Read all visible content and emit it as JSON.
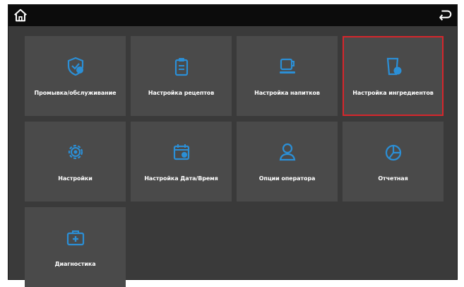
{
  "colors": {
    "screen_bg": "#3a3a3a",
    "tile_bg": "#4a4a4a",
    "icon_accent": "#2b8fd6",
    "selection": "#d6262c",
    "topbar_bg": "#0c0c0c"
  },
  "topbar": {
    "home_icon": "home-icon",
    "back_icon": "back-arrow-icon"
  },
  "tiles": [
    {
      "label": "Промывка/обслуживание",
      "icon": "shield-icon"
    },
    {
      "label": "Настройка рецептов",
      "icon": "clipboard-icon"
    },
    {
      "label": "Настройка напитков",
      "icon": "cup-icon"
    },
    {
      "label": "Настройка ингредиентов",
      "icon": "canister-icon"
    },
    {
      "label": "Настройки",
      "icon": "gear-icon"
    },
    {
      "label": "Настройка Дата/Время",
      "icon": "calendar-icon"
    },
    {
      "label": "Опции оператора",
      "icon": "user-icon"
    },
    {
      "label": "Отчетная",
      "icon": "pie-chart-icon"
    },
    {
      "label": "Диагностика",
      "icon": "medical-kit-icon"
    }
  ],
  "selected_tile": "Настройка ингредиентов"
}
